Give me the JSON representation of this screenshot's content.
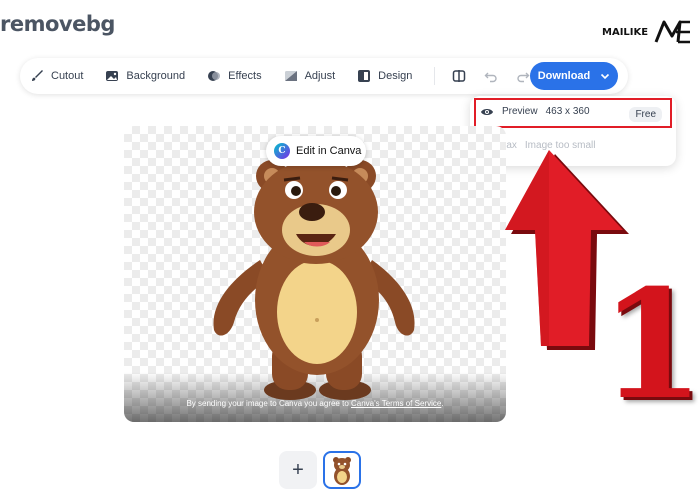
{
  "brand": {
    "first": "remove",
    "second": "bg"
  },
  "watermark": {
    "text": "MAILIKE"
  },
  "toolbar": {
    "cutout": "Cutout",
    "background": "Background",
    "effects": "Effects",
    "adjust": "Adjust",
    "design": "Design",
    "download": "Download"
  },
  "dropdown": {
    "preview_label": "Preview",
    "preview_size": "463 x 360",
    "preview_badge": "Free",
    "max_label": "Max",
    "max_note": "Image too small"
  },
  "canvas": {
    "edit_button": "Edit in Canva",
    "tos_prefix": "By sending your image to Canva you agree to ",
    "tos_link": "Canva's Terms of Service",
    "tos_suffix": "."
  },
  "thumbs": {
    "add": "+"
  },
  "annotation": {
    "number": "1"
  },
  "colors": {
    "accent": "#2a72e8",
    "annotation_red": "#e11d27"
  }
}
